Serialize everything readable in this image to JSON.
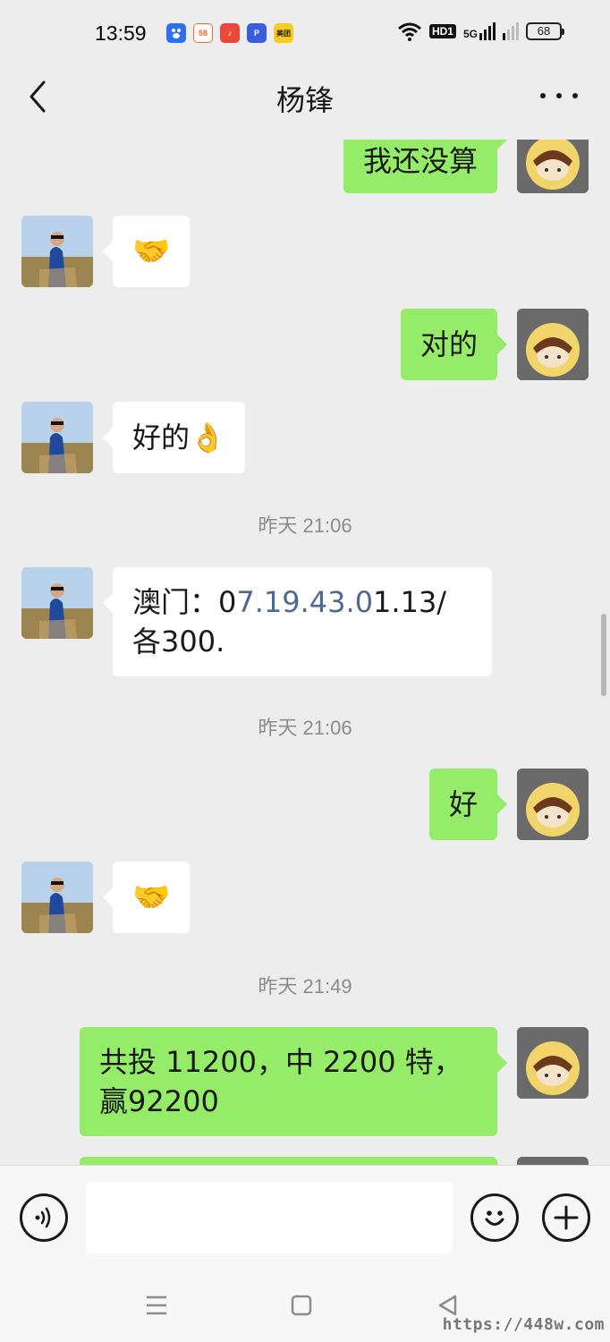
{
  "status_bar": {
    "time": "13:59",
    "apps": [
      {
        "icon": "baidu-icon",
        "text": "",
        "color": "#2f6ef0"
      },
      {
        "icon": "58-icon",
        "text": "58",
        "color": "#f26b22"
      },
      {
        "icon": "music-icon",
        "text": "♪",
        "color": "#e8493a"
      },
      {
        "icon": "pdd-icon",
        "text": "P",
        "color": "#3a5de0"
      },
      {
        "icon": "meituan-icon",
        "text": "美团",
        "color": "#f7cc1d"
      }
    ],
    "hd_label": "HD1",
    "network_label": "5G",
    "battery": "68"
  },
  "header": {
    "title": "杨锋"
  },
  "messages": [
    {
      "text": "我还没算"
    },
    {
      "text": "🤝"
    },
    {
      "text": "对的"
    },
    {
      "text": "好的👌"
    },
    {
      "timestamp": "昨天 21:06"
    },
    {
      "prefix": "澳门：0",
      "link": "7.19.43.0",
      "suffix": "1.13/各300."
    },
    {
      "timestamp": "昨天 21:06"
    },
    {
      "text": "好"
    },
    {
      "text": "🤝"
    },
    {
      "timestamp": "昨天 21:49"
    },
    {
      "text": "共投 11200，中 2200 特，赢92200"
    }
  ],
  "input": {
    "placeholder": ""
  },
  "watermark": "https://448w.com"
}
